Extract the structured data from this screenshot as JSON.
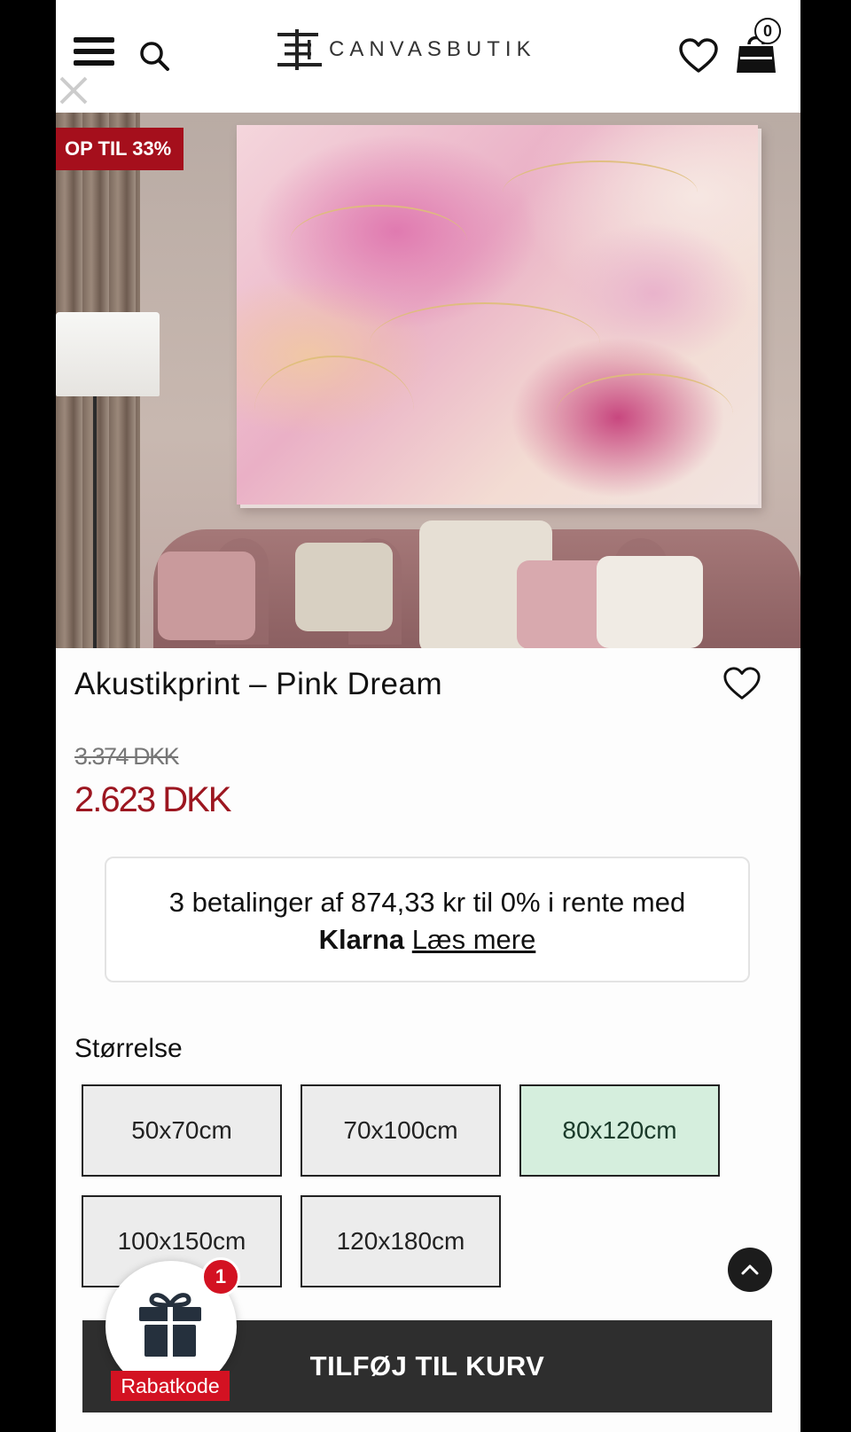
{
  "header": {
    "brand_name": "CANVASBUTIK",
    "cart_count": "0",
    "icons": [
      "menu-icon",
      "search-icon",
      "heart-icon",
      "shopping-bag-icon",
      "close-icon"
    ]
  },
  "hero": {
    "sale_badge": "OP TIL 33%"
  },
  "product": {
    "title": "Akustikprint – Pink Dream",
    "price_old": "3.374 DKK",
    "price_new": "2.623 DKK"
  },
  "klarna": {
    "line1": "3 betalinger af 874,33 kr til 0% i rente med",
    "brand": "Klarna",
    "link": "Læs mere"
  },
  "sizes": {
    "label": "Størrelse",
    "options": [
      "50x70cm",
      "70x100cm",
      "80x120cm",
      "100x150cm",
      "120x180cm"
    ],
    "selected": "80x120cm"
  },
  "cart_button": {
    "label": "TILFØJ TIL KURV"
  },
  "discount_widget": {
    "badge_count": "1",
    "label": "Rabatkode"
  },
  "colors": {
    "sale_red": "#a50f1c",
    "price_red": "#9c1620",
    "selected_size_bg": "#d5eedd",
    "cart_button_bg": "#2e2e2e",
    "widget_red": "#d31222"
  }
}
